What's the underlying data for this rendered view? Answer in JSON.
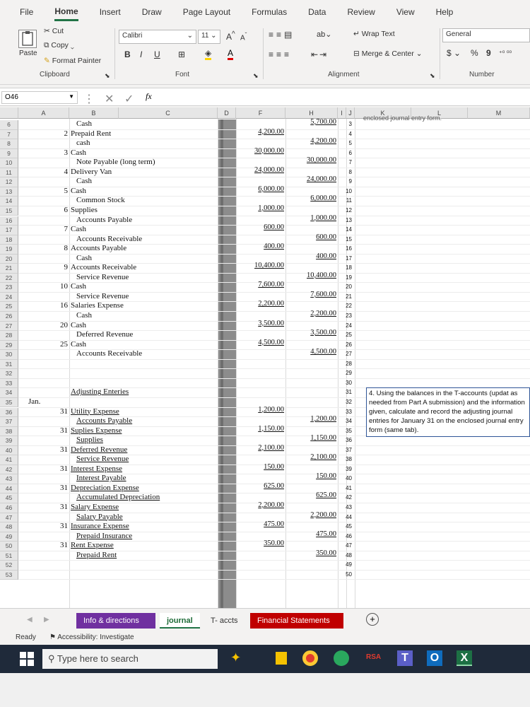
{
  "menu": {
    "tabs": [
      "File",
      "Home",
      "Insert",
      "Draw",
      "Page Layout",
      "Formulas",
      "Data",
      "Review",
      "View",
      "Help"
    ],
    "active": "Home"
  },
  "ribbon": {
    "clipboard": {
      "cut": "Cut",
      "copy": "Copy",
      "paste": "Paste",
      "format_painter": "Format Painter",
      "label": "Clipboard"
    },
    "font": {
      "name": "Calibri",
      "size": "11",
      "grow": "A",
      "shrink": "A",
      "bold": "B",
      "italic": "I",
      "underline": "U",
      "label": "Font"
    },
    "alignment": {
      "wrap_text": "Wrap Text",
      "merge_center": "Merge & Center",
      "label": "Alignment"
    },
    "number": {
      "format": "General",
      "currency": "$",
      "percent": "%",
      "comma": "9",
      "label": "Number"
    }
  },
  "formula_bar": {
    "name_box": "O46",
    "fx": "fx",
    "cancel": "✕",
    "enter": "✓",
    "value": ""
  },
  "columns": [
    "A",
    "B",
    "C",
    "D",
    "F",
    "H",
    "I",
    "J",
    "K",
    "L",
    "M"
  ],
  "top_partial_text": "enclosed journal entry form.",
  "rows": [
    {
      "row": "6",
      "num": "",
      "name": "Cash",
      "indent": true,
      "debit": "",
      "credit": "5,700.00",
      "i": "3"
    },
    {
      "row": "7",
      "num": "2",
      "name": "Prepaid Rent",
      "indent": false,
      "debit": "4,200.00",
      "credit": "",
      "i": "4"
    },
    {
      "row": "8",
      "num": "",
      "name": "cash",
      "indent": true,
      "debit": "",
      "credit": "4,200.00",
      "i": "5"
    },
    {
      "row": "9",
      "num": "3",
      "name": "Cash",
      "indent": false,
      "debit": "30,000.00",
      "credit": "",
      "i": "6"
    },
    {
      "row": "10",
      "num": "",
      "name": "Note Payable (long term)",
      "indent": true,
      "debit": "",
      "credit": "30,000.00",
      "i": "7"
    },
    {
      "row": "11",
      "num": "4",
      "name": "Delivery Van",
      "indent": false,
      "debit": "24,000.00",
      "credit": "",
      "i": "8"
    },
    {
      "row": "12",
      "num": "",
      "name": "Cash",
      "indent": true,
      "debit": "",
      "credit": "24,000.00",
      "i": "9"
    },
    {
      "row": "13",
      "num": "5",
      "name": "Cash",
      "indent": false,
      "debit": "6,000.00",
      "credit": "",
      "i": "10"
    },
    {
      "row": "14",
      "num": "",
      "name": "Common Stock",
      "indent": true,
      "debit": "",
      "credit": "6,000.00",
      "i": "11"
    },
    {
      "row": "15",
      "num": "6",
      "name": "Supplies",
      "indent": false,
      "debit": "1,000.00",
      "credit": "",
      "i": "12"
    },
    {
      "row": "16",
      "num": "",
      "name": "Accounts Payable",
      "indent": true,
      "debit": "",
      "credit": "1,000.00",
      "i": "13"
    },
    {
      "row": "17",
      "num": "7",
      "name": "Cash",
      "indent": false,
      "debit": "600.00",
      "credit": "",
      "i": "14"
    },
    {
      "row": "18",
      "num": "",
      "name": "Accounts Receivable",
      "indent": true,
      "debit": "",
      "credit": "600.00",
      "i": "15"
    },
    {
      "row": "19",
      "num": "8",
      "name": "Accounts Payable",
      "indent": false,
      "debit": "400.00",
      "credit": "",
      "i": "16"
    },
    {
      "row": "20",
      "num": "",
      "name": "Cash",
      "indent": true,
      "debit": "",
      "credit": "400.00",
      "i": "17"
    },
    {
      "row": "21",
      "num": "9",
      "name": "Accounts Receivable",
      "indent": false,
      "debit": "10,400.00",
      "credit": "",
      "i": "18"
    },
    {
      "row": "22",
      "num": "",
      "name": "Service Revenue",
      "indent": true,
      "debit": "",
      "credit": "10,400.00",
      "i": "19"
    },
    {
      "row": "23",
      "num": "10",
      "name": "Cash",
      "indent": false,
      "debit": "7,600.00",
      "credit": "",
      "i": "20"
    },
    {
      "row": "24",
      "num": "",
      "name": "Service Revenue",
      "indent": true,
      "debit": "",
      "credit": "7,600.00",
      "i": "21"
    },
    {
      "row": "25",
      "num": "16",
      "name": "Salaries Expense",
      "indent": false,
      "debit": "2,200.00",
      "credit": "",
      "i": "22"
    },
    {
      "row": "26",
      "num": "",
      "name": "Cash",
      "indent": true,
      "debit": "",
      "credit": "2,200.00",
      "i": "23"
    },
    {
      "row": "27",
      "num": "20",
      "name": "Cash",
      "indent": false,
      "debit": "3,500.00",
      "credit": "",
      "i": "24"
    },
    {
      "row": "28",
      "num": "",
      "name": "Deferred Revenue",
      "indent": true,
      "debit": "",
      "credit": "3,500.00",
      "i": "25"
    },
    {
      "row": "29",
      "num": "25",
      "name": "Cash",
      "indent": false,
      "debit": "4,500.00",
      "credit": "",
      "i": "26"
    },
    {
      "row": "30",
      "num": "",
      "name": "Accounts Receivable",
      "indent": true,
      "debit": "",
      "credit": "4,500.00",
      "i": "27"
    },
    {
      "row": "31",
      "num": "",
      "name": "",
      "indent": false,
      "debit": "",
      "credit": "",
      "i": "28"
    },
    {
      "row": "32",
      "num": "",
      "name": "",
      "indent": false,
      "debit": "",
      "credit": "",
      "i": "29"
    },
    {
      "row": "33",
      "num": "",
      "name": "",
      "indent": false,
      "debit": "",
      "credit": "",
      "i": "30"
    },
    {
      "row": "34",
      "num": "",
      "name": "Adjusting Enteries",
      "indent": false,
      "debit": "",
      "credit": "",
      "i": "31"
    },
    {
      "row": "35",
      "num": "Jan.",
      "name": "",
      "indent": false,
      "debit": "",
      "credit": "",
      "i": "32"
    },
    {
      "row": "36",
      "num": "31",
      "name": "Utility Expense",
      "indent": false,
      "debit": "1,200.00",
      "credit": "",
      "i": "33"
    },
    {
      "row": "37",
      "num": "",
      "name": "Accounts Payable",
      "indent": true,
      "debit": "",
      "credit": "1,200.00",
      "i": "34"
    },
    {
      "row": "38",
      "num": "31",
      "name": "Suplies Expense",
      "indent": false,
      "debit": "1,150.00",
      "credit": "",
      "i": "35"
    },
    {
      "row": "39",
      "num": "",
      "name": "Supplies",
      "indent": true,
      "debit": "",
      "credit": "1,150.00",
      "i": "36"
    },
    {
      "row": "40",
      "num": "31",
      "name": "Deferred Revenue",
      "indent": false,
      "debit": "2,100.00",
      "credit": "",
      "i": "37"
    },
    {
      "row": "41",
      "num": "",
      "name": "Service Revenue",
      "indent": true,
      "debit": "",
      "credit": "2,100.00",
      "i": "38"
    },
    {
      "row": "42",
      "num": "31",
      "name": "Interest Expense",
      "indent": false,
      "debit": "150.00",
      "credit": "",
      "i": "39"
    },
    {
      "row": "43",
      "num": "",
      "name": "Interest Payable",
      "indent": true,
      "debit": "",
      "credit": "150.00",
      "i": "40"
    },
    {
      "row": "44",
      "num": "31",
      "name": "Depreciation Expense",
      "indent": false,
      "debit": "625.00",
      "credit": "",
      "i": "41"
    },
    {
      "row": "45",
      "num": "",
      "name": "Accumulated Depreciation",
      "indent": true,
      "debit": "",
      "credit": "625.00",
      "i": "42"
    },
    {
      "row": "46",
      "num": "31",
      "name": "Salary Expense",
      "indent": false,
      "debit": "2,200.00",
      "credit": "",
      "i": "43"
    },
    {
      "row": "47",
      "num": "",
      "name": "Salary Payable",
      "indent": true,
      "debit": "",
      "credit": "2,200.00",
      "i": "44"
    },
    {
      "row": "48",
      "num": "31",
      "name": "Insurance Expense",
      "indent": false,
      "debit": "475.00",
      "credit": "",
      "i": "45"
    },
    {
      "row": "49",
      "num": "",
      "name": "Prepaid Insurance",
      "indent": true,
      "debit": "",
      "credit": "475.00",
      "i": "46"
    },
    {
      "row": "50",
      "num": "31",
      "name": "Rent Expense",
      "indent": false,
      "debit": "350.00",
      "credit": "",
      "i": "47"
    },
    {
      "row": "51",
      "num": "",
      "name": "Prepaid Rent",
      "indent": true,
      "debit": "",
      "credit": "350.00",
      "i": "48"
    },
    {
      "row": "52",
      "num": "",
      "name": "",
      "indent": false,
      "debit": "",
      "credit": "",
      "i": "49"
    },
    {
      "row": "53",
      "num": "",
      "name": "",
      "indent": false,
      "debit": "",
      "credit": "",
      "i": "50"
    }
  ],
  "instruction_box": "4. Using the balances in the T-accounts (updat as needed from Part A submission) and the information given, calculate and record the adjusting journal entries for January 31 on the enclosed journal entry form (same tab).",
  "sheet_tabs": [
    {
      "label": "Info & directions",
      "style": "purple"
    },
    {
      "label": "journal",
      "style": "active"
    },
    {
      "label": "T- accts",
      "style": "plain"
    },
    {
      "label": "Financial Statements",
      "style": "red"
    }
  ],
  "add_sheet": "+",
  "status": {
    "ready": "Ready",
    "accessibility": "Accessibility: Investigate"
  },
  "taskbar": {
    "search_placeholder": "Type here to search"
  },
  "colors": {
    "excel_green": "#217346",
    "tab_purple": "#7030a0",
    "tab_red": "#c00000",
    "instruction_border": "#2f5597",
    "column_d_fill": "#8c8c8c"
  }
}
